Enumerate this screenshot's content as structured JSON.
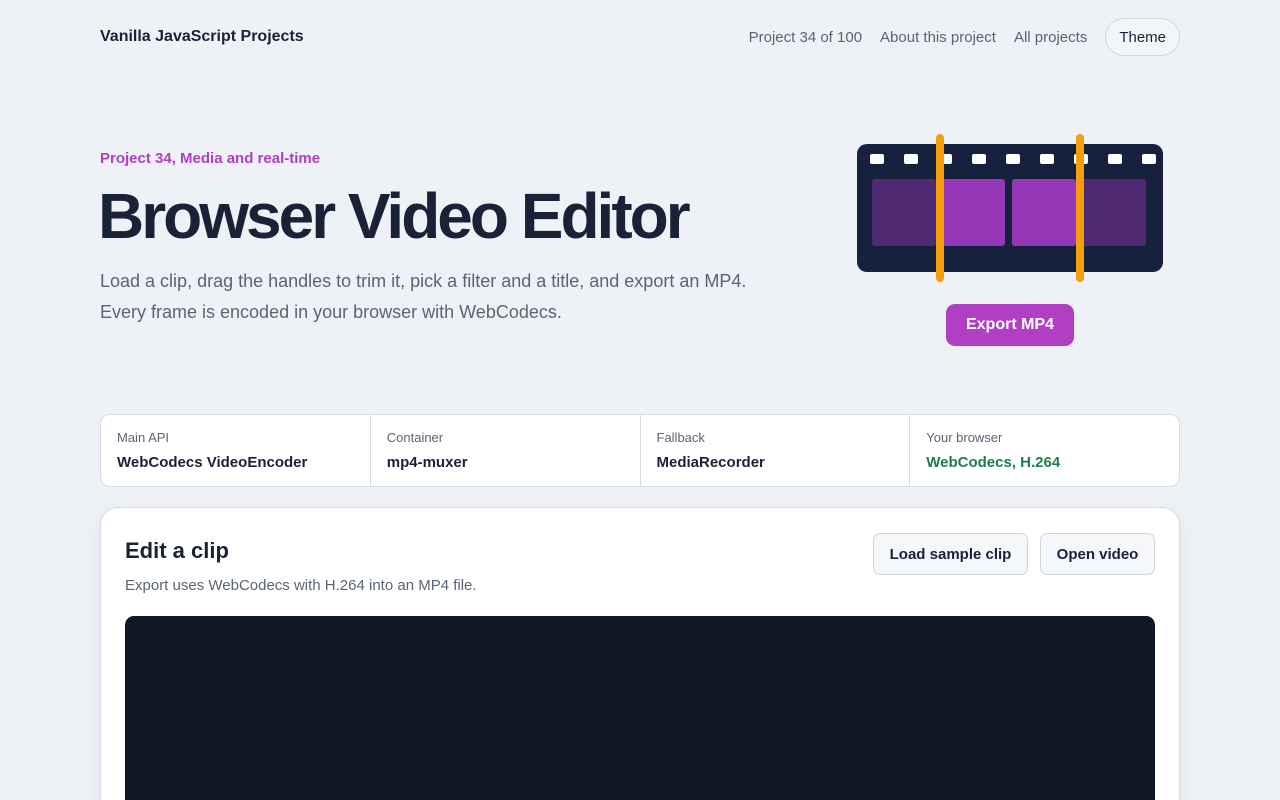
{
  "header": {
    "brand": "Vanilla JavaScript Projects",
    "nav": {
      "progress": "Project 34 of 100",
      "about": "About this project",
      "all": "All projects",
      "theme": "Theme"
    }
  },
  "hero": {
    "eyebrow": "Project 34, Media and real-time",
    "title": "Browser Video Editor",
    "description": "Load a clip, drag the handles to trim it, pick a filter and a title, and export an MP4. Every frame is encoded in your browser with WebCodecs.",
    "export_label": "Export MP4"
  },
  "info": [
    {
      "label": "Main API",
      "value": "WebCodecs VideoEncoder"
    },
    {
      "label": "Container",
      "value": "mp4-muxer"
    },
    {
      "label": "Fallback",
      "value": "MediaRecorder"
    },
    {
      "label": "Your browser",
      "value": "WebCodecs, H.264"
    }
  ],
  "editor": {
    "title": "Edit a clip",
    "subtitle": "Export uses WebCodecs with H.264 into an MP4 file.",
    "load_sample_label": "Load sample clip",
    "open_video_label": "Open video"
  },
  "colors": {
    "accent": "#b03fc4",
    "handle": "#f59e0b",
    "ok": "#1a7f4b",
    "dark": "#1a2238"
  }
}
